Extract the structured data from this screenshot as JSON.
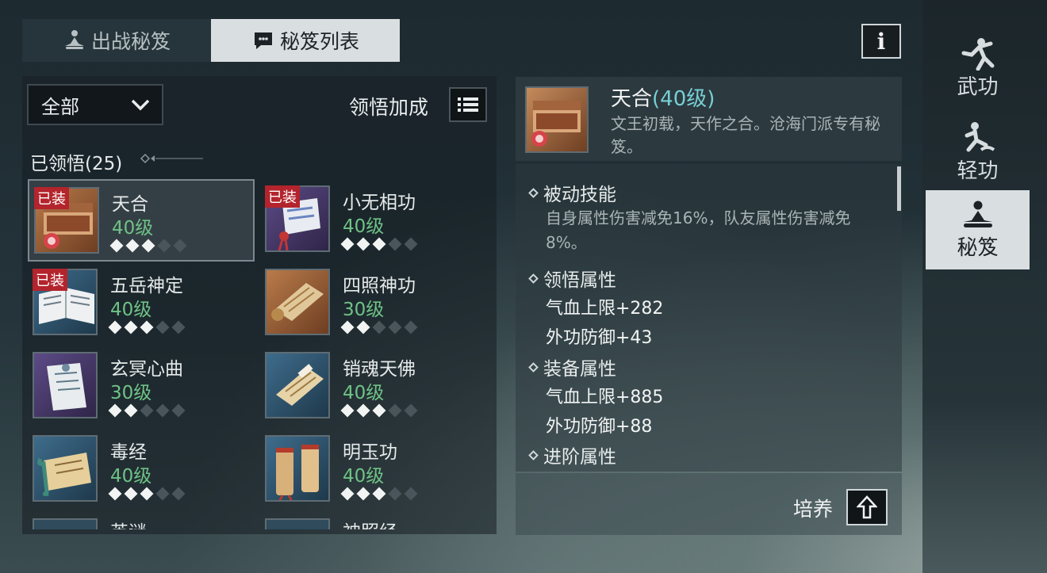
{
  "tabs": [
    {
      "label": "出战秘笈"
    },
    {
      "label": "秘笈列表"
    }
  ],
  "info_label": "i",
  "filter": {
    "value": "全部"
  },
  "bonus_label": "领悟加成",
  "learned_label": "已领悟(25)",
  "cards": [
    {
      "name": "天合",
      "level": "40级",
      "badge": "已装",
      "stars": 3
    },
    {
      "name": "小无相功",
      "level": "40级",
      "badge": "已装",
      "stars": 3
    },
    {
      "name": "五岳神定",
      "level": "40级",
      "badge": "已装",
      "stars": 3
    },
    {
      "name": "四照神功",
      "level": "30级",
      "badge": "",
      "stars": 2
    },
    {
      "name": "玄冥心曲",
      "level": "30级",
      "badge": "",
      "stars": 2
    },
    {
      "name": "销魂天佛",
      "level": "40级",
      "badge": "",
      "stars": 3
    },
    {
      "name": "毒经",
      "level": "40级",
      "badge": "",
      "stars": 3
    },
    {
      "name": "明玉功",
      "level": "40级",
      "badge": "",
      "stars": 3
    },
    {
      "name": "英谜",
      "level": "",
      "badge": "",
      "stars": 0
    },
    {
      "name": "神照经",
      "level": "",
      "badge": "",
      "stars": 0
    }
  ],
  "detail": {
    "name": "天合",
    "level": "(40级)",
    "description": "文王初载，天作之合。沧海门派专有秘笈。",
    "sections": {
      "passive_title": "被动技能",
      "passive_text": "自身属性伤害减免16%，队友属性伤害减免8%。",
      "comprehend_title": "领悟属性",
      "comprehend_attrs": [
        "气血上限+282",
        "外功防御+43"
      ],
      "equip_title": "装备属性",
      "equip_attrs": [
        "气血上限+885",
        "外功防御+88"
      ],
      "advance_title": "进阶属性"
    },
    "cultivate_label": "培养"
  },
  "nav": [
    {
      "label": "武功",
      "icon": "martial-figure-icon"
    },
    {
      "label": "轻功",
      "icon": "qinggong-figure-icon"
    },
    {
      "label": "秘笈",
      "icon": "meditation-figure-icon",
      "active": true
    }
  ],
  "colors": {
    "level_green": "#6fc286",
    "badge_red": "#b3242c",
    "detail_level_cyan": "#76cfd4"
  }
}
